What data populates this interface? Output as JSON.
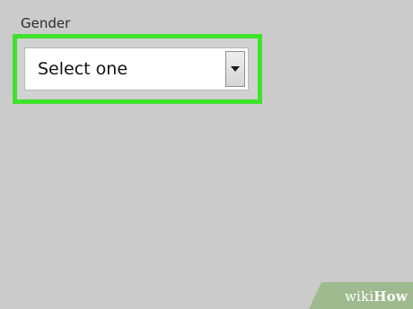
{
  "form": {
    "label": "Gender",
    "select": {
      "value": "Select one"
    }
  },
  "colors": {
    "background": "#cbcbcb",
    "highlight": "#3ee22a"
  },
  "icons": {
    "dropdown": "chevron-down-icon"
  },
  "watermark": {
    "wiki": "wiki",
    "how": "How"
  }
}
